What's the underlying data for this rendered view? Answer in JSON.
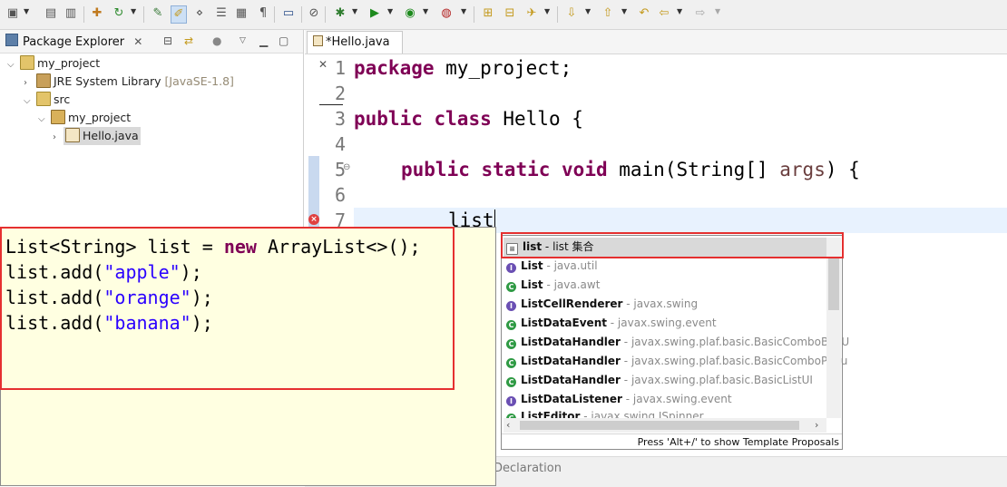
{
  "package_explorer": {
    "title": "Package Explorer",
    "tree": [
      {
        "label": "my_project",
        "extra": ""
      },
      {
        "label": "JRE System Library",
        "extra": "[JavaSE-1.8]"
      },
      {
        "label": "src",
        "extra": ""
      },
      {
        "label": "my_project",
        "extra": ""
      },
      {
        "label": "Hello.java",
        "extra": ""
      }
    ]
  },
  "editor": {
    "tab_title": "*Hello.java",
    "line_numbers": [
      "1",
      "2",
      "3",
      "4",
      "5",
      "6",
      "7"
    ],
    "code": {
      "l1_kw": "package",
      "l1_rest": " my_project;",
      "l3_kw1": "public",
      "l3_kw2": "class",
      "l3_rest": " Hello {",
      "l5_kw1": "public",
      "l5_kw2": "static",
      "l5_kw3": "void",
      "l5_rest": " main(String[] ",
      "l5_param": "args",
      "l5_end": ") {",
      "l7_text": "list"
    }
  },
  "hover": {
    "line1_pre": "List<String> list = ",
    "line1_kw": "new",
    "line1_post": " ArrayList<>();",
    "line2_pre": "list.add(",
    "line2_str": "\"apple\"",
    "line2_post": ");",
    "line3_pre": "list.add(",
    "line3_str": "\"orange\"",
    "line3_post": ");",
    "line4_pre": "list.add(",
    "line4_str": "\"banana\"",
    "line4_post": ");"
  },
  "proposals": {
    "items": [
      {
        "name": "list",
        "desc": " - list 集合",
        "kind": "template"
      },
      {
        "name": "List",
        "desc": " - java.util",
        "kind": "interface"
      },
      {
        "name": "List",
        "desc": " - java.awt",
        "kind": "class"
      },
      {
        "name": "ListCellRenderer",
        "desc": " - javax.swing",
        "kind": "interface"
      },
      {
        "name": "ListDataEvent",
        "desc": " - javax.swing.event",
        "kind": "class"
      },
      {
        "name": "ListDataHandler",
        "desc": " - javax.swing.plaf.basic.BasicComboBoxU",
        "kind": "class"
      },
      {
        "name": "ListDataHandler",
        "desc": " - javax.swing.plaf.basic.BasicComboPopu",
        "kind": "class"
      },
      {
        "name": "ListDataHandler",
        "desc": " - javax.swing.plaf.basic.BasicListUI",
        "kind": "class"
      },
      {
        "name": "ListDataListener",
        "desc": " - javax.swing.event",
        "kind": "interface"
      },
      {
        "name": "ListEditor",
        "desc": " - javax.swing.JSpinner",
        "kind": "class"
      }
    ],
    "footer": "Press 'Alt+/' to show Template Proposals"
  },
  "bottom": {
    "declaration_tab": "Declaration"
  },
  "colors": {
    "highlight": "#e53030",
    "keyword": "#7f0055",
    "string": "#2a00ff",
    "hover_bg": "#ffffe1",
    "selection": "#d9d9d9"
  }
}
